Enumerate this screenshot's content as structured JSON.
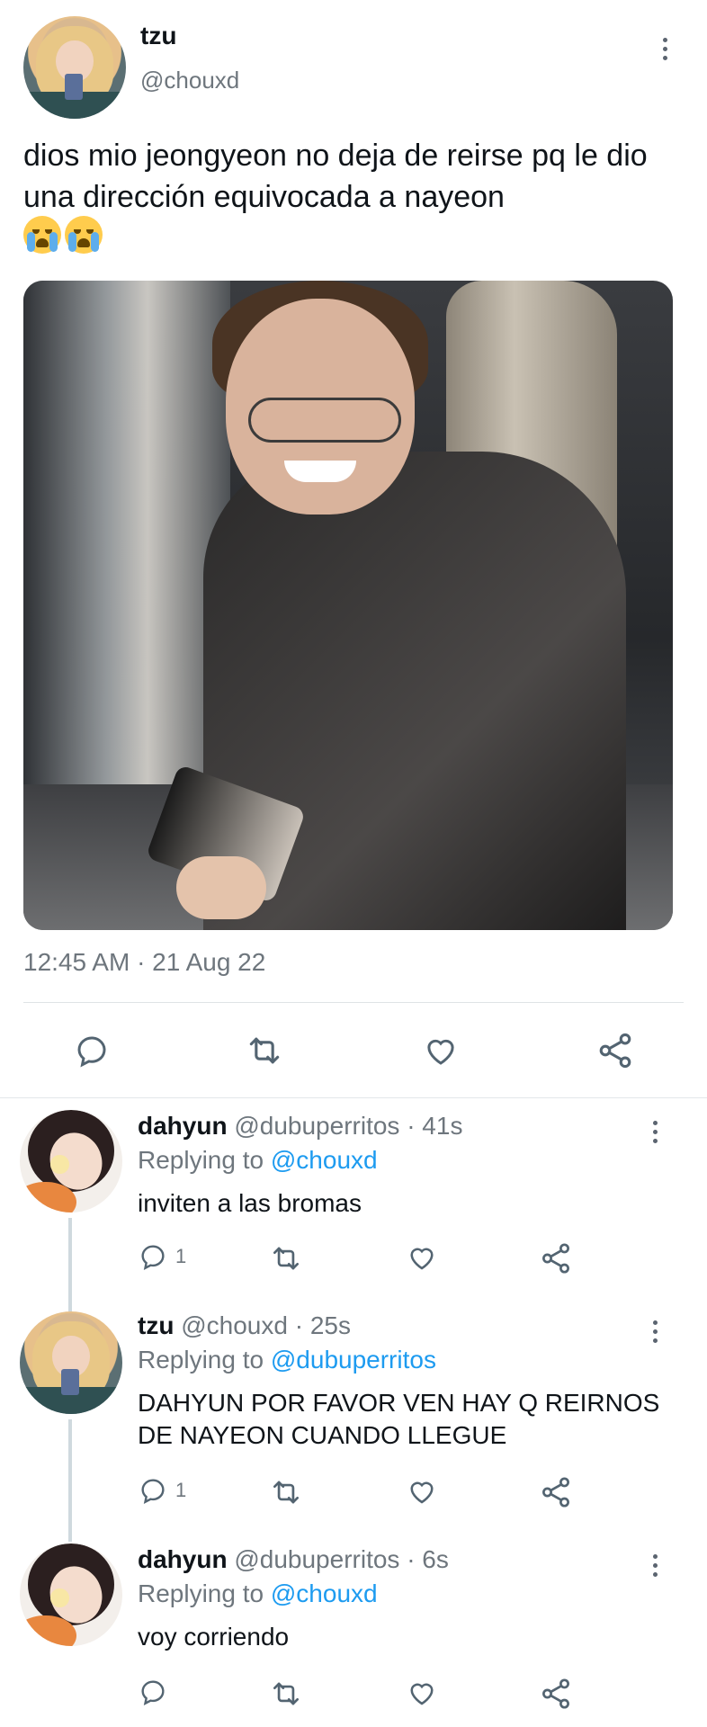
{
  "main_tweet": {
    "author_name": "tzu",
    "author_handle": "@chouxd",
    "text": "dios mio jeongyeon no deja de reirse pq le dio una dirección equivocada a nayeon",
    "emojis": [
      "loudly-crying-face",
      "loudly-crying-face"
    ],
    "timestamp": "12:45 AM · 21 Aug 22",
    "actions": [
      "reply-icon",
      "retweet-icon",
      "like-icon",
      "share-icon"
    ]
  },
  "replies": [
    {
      "author_name": "dahyun",
      "meta": "@dubuperritos · 41s",
      "replying_prefix": "Replying to",
      "replying_to": "@chouxd",
      "text": "inviten a las bromas",
      "reply_count": "1"
    },
    {
      "author_name": "tzu",
      "meta": "@chouxd · 25s",
      "replying_prefix": "Replying to",
      "replying_to": "@dubuperritos",
      "text": "DAHYUN POR FAVOR VEN HAY Q REIRNOS DE NAYEON CUANDO LLEGUE",
      "reply_count": "1"
    },
    {
      "author_name": "dahyun",
      "meta": "@dubuperritos · 6s",
      "replying_prefix": "Replying to",
      "replying_to": "@chouxd",
      "text": "voy corriendo",
      "reply_count": ""
    }
  ],
  "colors": {
    "link": "#1d9bf0",
    "secondary_text": "#6e767d",
    "icon": "#536471",
    "divider": "#dfe3e6"
  }
}
